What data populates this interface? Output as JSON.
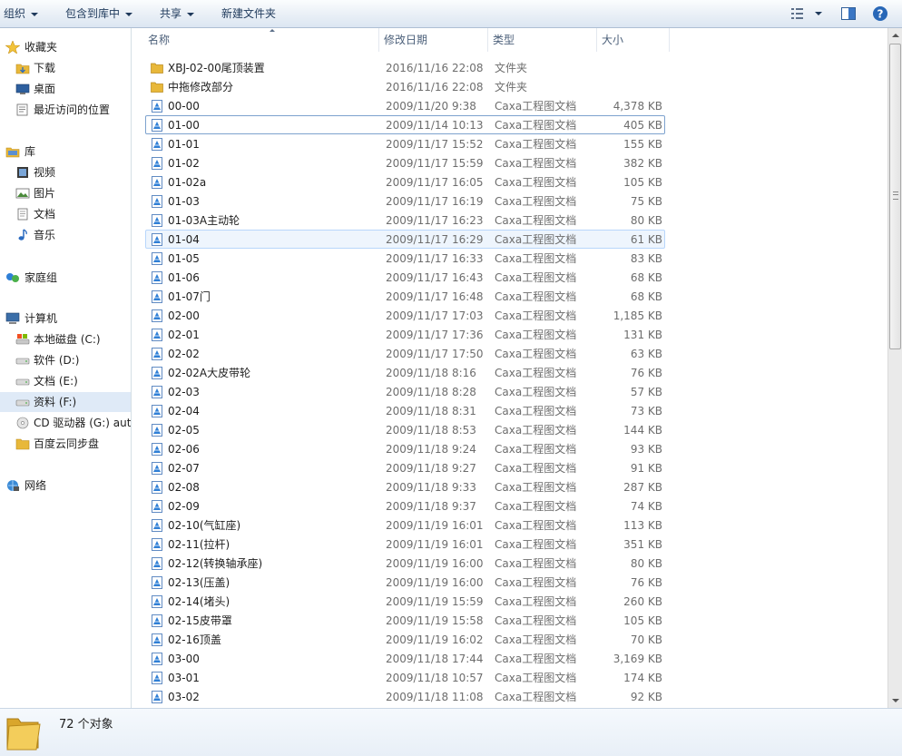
{
  "toolbar": {
    "organize": "组织",
    "include_in_library": "包含到库中",
    "share": "共享",
    "new_folder": "新建文件夹"
  },
  "nav": {
    "favorites": "收藏夹",
    "downloads": "下载",
    "desktop": "桌面",
    "recent": "最近访问的位置",
    "libraries": "库",
    "videos": "视频",
    "pictures": "图片",
    "documents": "文档",
    "music": "音乐",
    "homegroup": "家庭组",
    "computer": "计算机",
    "drive_c": "本地磁盘 (C:)",
    "drive_d": "软件 (D:)",
    "drive_e": "文档 (E:)",
    "drive_f": "资料 (F:)",
    "drive_g": "CD 驱动器 (G:) auto",
    "baidu": "百度云同步盘",
    "network": "网络"
  },
  "columns": {
    "name": "名称",
    "date": "修改日期",
    "type": "类型",
    "size": "大小"
  },
  "files": [
    {
      "name": "XBJ-02-00尾顶装置",
      "date": "2016/11/16 22:08",
      "type": "文件夹",
      "size": "",
      "kind": "folder"
    },
    {
      "name": "中拖修改部分",
      "date": "2016/11/16 22:08",
      "type": "文件夹",
      "size": "",
      "kind": "folder"
    },
    {
      "name": "00-00",
      "date": "2009/11/20 9:38",
      "type": "Caxa工程图文档",
      "size": "4,378 KB",
      "kind": "doc"
    },
    {
      "name": "01-00",
      "date": "2009/11/14 10:13",
      "type": "Caxa工程图文档",
      "size": "405 KB",
      "kind": "doc"
    },
    {
      "name": "01-01",
      "date": "2009/11/17 15:52",
      "type": "Caxa工程图文档",
      "size": "155 KB",
      "kind": "doc"
    },
    {
      "name": "01-02",
      "date": "2009/11/17 15:59",
      "type": "Caxa工程图文档",
      "size": "382 KB",
      "kind": "doc"
    },
    {
      "name": "01-02a",
      "date": "2009/11/17 16:05",
      "type": "Caxa工程图文档",
      "size": "105 KB",
      "kind": "doc"
    },
    {
      "name": "01-03",
      "date": "2009/11/17 16:19",
      "type": "Caxa工程图文档",
      "size": "75 KB",
      "kind": "doc"
    },
    {
      "name": "01-03A主动轮",
      "date": "2009/11/17 16:23",
      "type": "Caxa工程图文档",
      "size": "80 KB",
      "kind": "doc"
    },
    {
      "name": "01-04",
      "date": "2009/11/17 16:29",
      "type": "Caxa工程图文档",
      "size": "61 KB",
      "kind": "doc"
    },
    {
      "name": "01-05",
      "date": "2009/11/17 16:33",
      "type": "Caxa工程图文档",
      "size": "83 KB",
      "kind": "doc"
    },
    {
      "name": "01-06",
      "date": "2009/11/17 16:43",
      "type": "Caxa工程图文档",
      "size": "68 KB",
      "kind": "doc"
    },
    {
      "name": "01-07门",
      "date": "2009/11/17 16:48",
      "type": "Caxa工程图文档",
      "size": "68 KB",
      "kind": "doc"
    },
    {
      "name": "02-00",
      "date": "2009/11/17 17:03",
      "type": "Caxa工程图文档",
      "size": "1,185 KB",
      "kind": "doc"
    },
    {
      "name": "02-01",
      "date": "2009/11/17 17:36",
      "type": "Caxa工程图文档",
      "size": "131 KB",
      "kind": "doc"
    },
    {
      "name": "02-02",
      "date": "2009/11/17 17:50",
      "type": "Caxa工程图文档",
      "size": "63 KB",
      "kind": "doc"
    },
    {
      "name": "02-02A大皮带轮",
      "date": "2009/11/18 8:16",
      "type": "Caxa工程图文档",
      "size": "76 KB",
      "kind": "doc"
    },
    {
      "name": "02-03",
      "date": "2009/11/18 8:28",
      "type": "Caxa工程图文档",
      "size": "57 KB",
      "kind": "doc"
    },
    {
      "name": "02-04",
      "date": "2009/11/18 8:31",
      "type": "Caxa工程图文档",
      "size": "73 KB",
      "kind": "doc"
    },
    {
      "name": "02-05",
      "date": "2009/11/18 8:53",
      "type": "Caxa工程图文档",
      "size": "144 KB",
      "kind": "doc"
    },
    {
      "name": "02-06",
      "date": "2009/11/18 9:24",
      "type": "Caxa工程图文档",
      "size": "93 KB",
      "kind": "doc"
    },
    {
      "name": "02-07",
      "date": "2009/11/18 9:27",
      "type": "Caxa工程图文档",
      "size": "91 KB",
      "kind": "doc"
    },
    {
      "name": "02-08",
      "date": "2009/11/18 9:33",
      "type": "Caxa工程图文档",
      "size": "287 KB",
      "kind": "doc"
    },
    {
      "name": "02-09",
      "date": "2009/11/18 9:37",
      "type": "Caxa工程图文档",
      "size": "74 KB",
      "kind": "doc"
    },
    {
      "name": "02-10(气缸座)",
      "date": "2009/11/19 16:01",
      "type": "Caxa工程图文档",
      "size": "113 KB",
      "kind": "doc"
    },
    {
      "name": "02-11(拉杆)",
      "date": "2009/11/19 16:01",
      "type": "Caxa工程图文档",
      "size": "351 KB",
      "kind": "doc"
    },
    {
      "name": "02-12(转换轴承座)",
      "date": "2009/11/19 16:00",
      "type": "Caxa工程图文档",
      "size": "80 KB",
      "kind": "doc"
    },
    {
      "name": "02-13(压盖)",
      "date": "2009/11/19 16:00",
      "type": "Caxa工程图文档",
      "size": "76 KB",
      "kind": "doc"
    },
    {
      "name": "02-14(堵头)",
      "date": "2009/11/19 15:59",
      "type": "Caxa工程图文档",
      "size": "260 KB",
      "kind": "doc"
    },
    {
      "name": "02-15皮带罩",
      "date": "2009/11/19 15:58",
      "type": "Caxa工程图文档",
      "size": "105 KB",
      "kind": "doc"
    },
    {
      "name": "02-16顶盖",
      "date": "2009/11/19 16:02",
      "type": "Caxa工程图文档",
      "size": "70 KB",
      "kind": "doc"
    },
    {
      "name": "03-00",
      "date": "2009/11/18 17:44",
      "type": "Caxa工程图文档",
      "size": "3,169 KB",
      "kind": "doc"
    },
    {
      "name": "03-01",
      "date": "2009/11/18 10:57",
      "type": "Caxa工程图文档",
      "size": "174 KB",
      "kind": "doc"
    },
    {
      "name": "03-02",
      "date": "2009/11/18 11:08",
      "type": "Caxa工程图文档",
      "size": "92 KB",
      "kind": "doc"
    }
  ],
  "row_states": {
    "selected_index": 3,
    "hover_index": 9
  },
  "details": {
    "count_text": "72 个对象"
  },
  "colors": {
    "accent": "#1e395b",
    "selection_border": "#7da2ce",
    "hover_border": "#b8d6fb",
    "folder": "#e8b83a"
  }
}
